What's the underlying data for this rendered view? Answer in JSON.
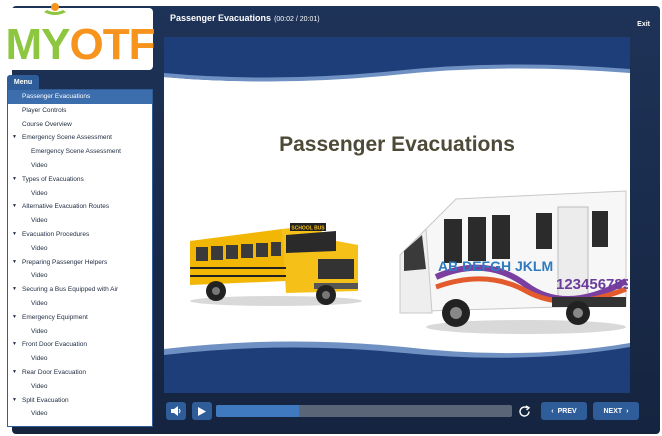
{
  "logo": {
    "text_m": "M",
    "text_y": "Y",
    "text_otf": "OTF",
    "icon": "person-icon"
  },
  "header": {
    "title": "Passenger Evacuations",
    "time": "(00:02 / 20:01)",
    "exit_label": "Exit"
  },
  "menu": {
    "tab_label": "Menu",
    "items": [
      {
        "label": "Passenger Evacuations",
        "level": 0,
        "active": true
      },
      {
        "label": "Player Controls",
        "level": 0
      },
      {
        "label": "Course Overview",
        "level": 0
      },
      {
        "label": "Emergency Scene Assessment",
        "level": 0,
        "expanded": true
      },
      {
        "label": "Emergency Scene Assessment",
        "level": 1
      },
      {
        "label": "Video",
        "level": 1
      },
      {
        "label": "Types of Evacuations",
        "level": 0,
        "expanded": true
      },
      {
        "label": "Video",
        "level": 1
      },
      {
        "label": "Alternative Evacuation Routes",
        "level": 0,
        "expanded": true
      },
      {
        "label": "Video",
        "level": 1
      },
      {
        "label": "Evacuation Procedures",
        "level": 0,
        "expanded": true
      },
      {
        "label": "Video",
        "level": 1
      },
      {
        "label": "Preparing Passenger Helpers",
        "level": 0,
        "expanded": true
      },
      {
        "label": "Video",
        "level": 1
      },
      {
        "label": "Securing a Bus Equipped with Air",
        "level": 0,
        "expanded": true
      },
      {
        "label": "Video",
        "level": 1
      },
      {
        "label": "Emergency Equipment",
        "level": 0,
        "expanded": true
      },
      {
        "label": "Video",
        "level": 1
      },
      {
        "label": "Front Door Evacuation",
        "level": 0,
        "expanded": true
      },
      {
        "label": "Video",
        "level": 1
      },
      {
        "label": "Rear Door Evacuation",
        "level": 0,
        "expanded": true
      },
      {
        "label": "Video",
        "level": 1
      },
      {
        "label": "Split Evacuation",
        "level": 0,
        "expanded": true
      },
      {
        "label": "Video",
        "level": 1
      }
    ]
  },
  "slide": {
    "title": "Passenger Evacuations",
    "school_bus_sign": "SCHOOL BUS",
    "paratransit_letters": "AB DEFGH JKLM",
    "paratransit_numbers": "123456789"
  },
  "player": {
    "progress": 0.28,
    "prev_label": "PREV",
    "next_label": "NEXT"
  },
  "colors": {
    "frame": "#1e3358",
    "accent": "#2f5d9a",
    "active_item": "#3c6dad",
    "slide_title": "#4d4a37",
    "logo_green": "#8dc63f",
    "logo_orange": "#f7941d"
  }
}
